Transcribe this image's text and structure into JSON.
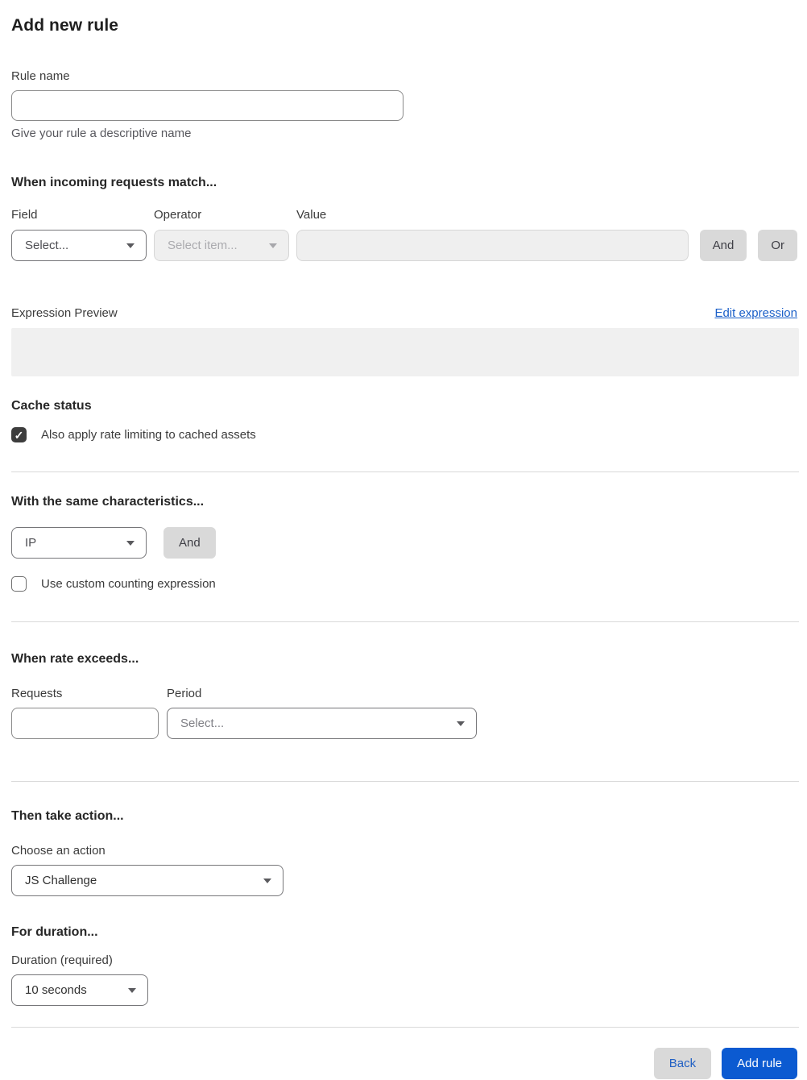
{
  "page": {
    "title": "Add new rule"
  },
  "rule_name": {
    "label": "Rule name",
    "value": "",
    "helper": "Give your rule a descriptive name"
  },
  "match_section": {
    "heading": "When incoming requests match...",
    "field": {
      "label": "Field",
      "selected": "Select..."
    },
    "operator": {
      "label": "Operator",
      "selected": "Select item...",
      "disabled": true
    },
    "value": {
      "label": "Value",
      "value": "",
      "disabled": true
    },
    "and_button": "And",
    "or_button": "Or",
    "expression_preview_label": "Expression Preview",
    "edit_expression_link": "Edit expression",
    "expression_value": ""
  },
  "cache_section": {
    "heading": "Cache status",
    "checkbox": {
      "label": "Also apply rate limiting to cached assets",
      "checked": true,
      "check_glyph": "✓"
    }
  },
  "characteristics_section": {
    "heading": "With the same characteristics...",
    "characteristic_select": {
      "selected": "IP"
    },
    "and_button": "And",
    "checkbox": {
      "label": "Use custom counting expression",
      "checked": false
    }
  },
  "rate_section": {
    "heading": "When rate exceeds...",
    "requests": {
      "label": "Requests",
      "value": ""
    },
    "period": {
      "label": "Period",
      "selected": "Select..."
    }
  },
  "action_section": {
    "heading": "Then take action...",
    "choose_label": "Choose an action",
    "action_select": {
      "selected": "JS Challenge"
    }
  },
  "duration_section": {
    "heading": "For duration...",
    "label": "Duration (required)",
    "duration_select": {
      "selected": "10 seconds"
    }
  },
  "footer": {
    "back_button": "Back",
    "submit_button": "Add rule"
  },
  "colors": {
    "primary_button": "#0b5ad1",
    "link": "#1a5fc8",
    "secondary_button_bg": "#d9d9d9",
    "secondary_button_text": "#2160c4",
    "checkbox_checked": "#3d3d3d",
    "disabled_bg": "#efefef",
    "preview_box_bg": "#f0f0f0",
    "divider": "#d9d9d9"
  }
}
